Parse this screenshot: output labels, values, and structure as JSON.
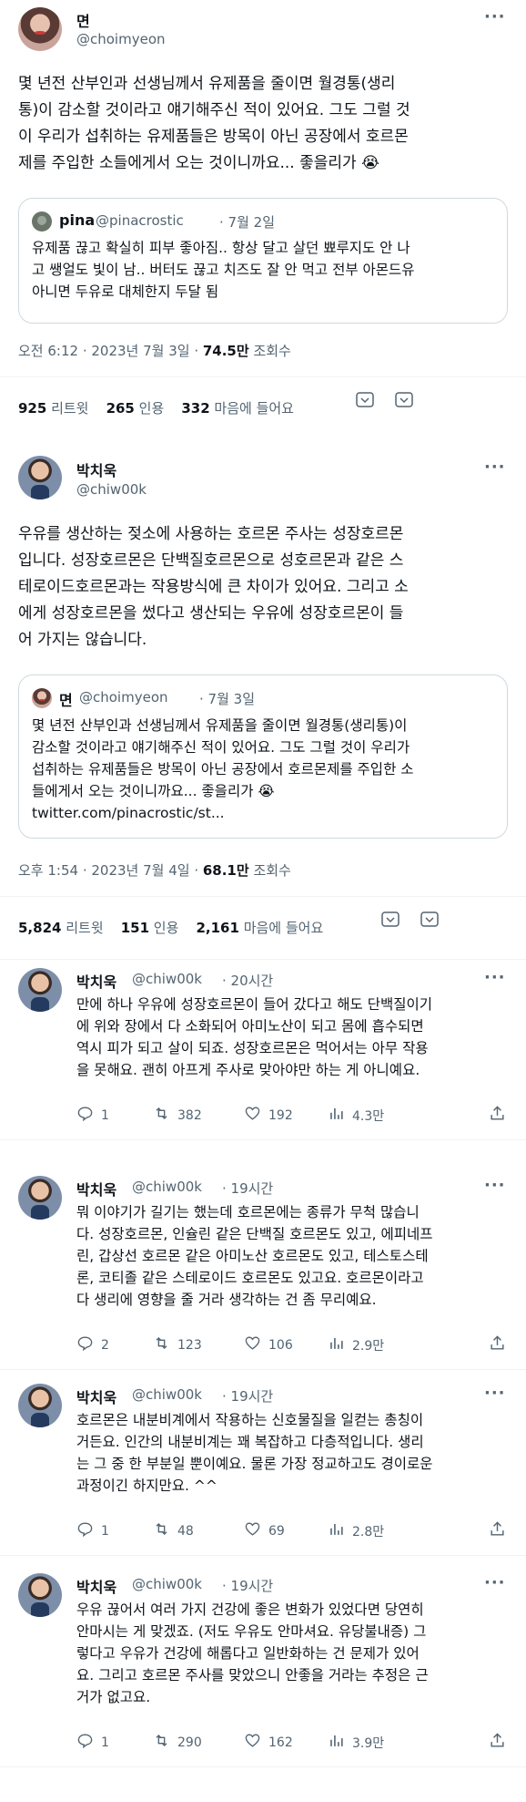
{
  "tweet1": {
    "name": "면",
    "handle": "@choimyeon",
    "text": "몇 년전 산부인과 선생님께서 유제품을 줄이면 월경통(생리\n통)이 감소할 것이라고 얘기해주신 적이 있어요. 그도 그럴 것\n이 우리가 섭취하는 유제품들은 방목이 아닌 공장에서 호르몬\n제를 주입한 소들에게서 오는 것이니까요... 좋을리가 😭",
    "quote": {
      "name": "pina",
      "handle": "@pinacrostic",
      "date": "· 7월 2일",
      "text": "유제품 끊고 확실히 피부 좋아짐.. 항상 달고 살던 뾰루지도 안 나\n고 쌩얼도 빛이 남.. 버터도 끊고 치즈도 잘 안 먹고 전부 아몬드유\n아니면 두유로 대체한지 두달 됨"
    },
    "time_prefix": "오전 6:12 · 2023년 7월 3일 · ",
    "views": "74.5만",
    "views_label": " 조회수",
    "retweets": "925",
    "retweets_label": " 리트윗",
    "quotes": "265",
    "quotes_label": " 인용",
    "likes": "332",
    "likes_label": " 마음에 들어요"
  },
  "tweet2": {
    "name": "박치욱",
    "handle": "@chiw00k",
    "text": "우유를 생산하는 젖소에 사용하는 호르몬 주사는 성장호르몬\n입니다. 성장호르몬은 단백질호르몬으로 성호르몬과 같은 스\n테로이드호르몬과는 작용방식에 큰 차이가 있어요. 그리고 소\n에게 성장호르몬을 썼다고 생산되는 우유에 성장호르몬이 들\n어 가지는 않습니다.",
    "quote": {
      "name": "면",
      "handle": "@choimyeon",
      "date": "· 7월 3일",
      "text": "몇 년전 산부인과 선생님께서 유제품을 줄이면 월경통(생리통)이\n감소할 것이라고 얘기해주신 적이 있어요. 그도 그럴 것이 우리가\n섭취하는 유제품들은 방목이 아닌 공장에서 호르몬제를 주입한 소\n들에게서 오는 것이니까요... 좋을리가 😭",
      "link": "twitter.com/pinacrostic/st..."
    },
    "time_prefix": "오후 1:54 · 2023년 7월 4일 · ",
    "views": "68.1만",
    "views_label": " 조회수",
    "retweets": "5,824",
    "retweets_label": " 리트윗",
    "quotes": "151",
    "quotes_label": " 인용",
    "likes": "2,161",
    "likes_label": " 마음에 들어요"
  },
  "replies": [
    {
      "name": "박치욱",
      "handle": "@chiw00k",
      "time": "· 20시간",
      "text": "만에 하나 우유에 성장호르몬이 들어 갔다고 해도 단백질이기\n에 위와 장에서 다 소화되어 아미노산이 되고 몸에 흡수되면\n역시 피가 되고 살이 되죠. 성장호르몬은 먹어서는 아무 작용\n을 못해요. 괜히 아프게 주사로 맞아야만 하는 게 아니예요.",
      "reply_count": "1",
      "retweet_count": "382",
      "like_count": "192",
      "view_count": "4.3만"
    },
    {
      "name": "박치욱",
      "handle": "@chiw00k",
      "time": "· 19시간",
      "text": "뭐 이야기가 길기는 했는데 호르몬에는 종류가 무척 많습니\n다. 성장호르몬, 인슐린 같은 단백질 호르몬도 있고, 에피네프\n린, 갑상선 호르몬 같은 아미노산 호르몬도 있고, 테스토스테\n론, 코티졸 같은 스테로이드 호르몬도 있고요. 호르몬이라고\n다 생리에 영향을 줄 거라 생각하는 건 좀 무리예요.",
      "reply_count": "2",
      "retweet_count": "123",
      "like_count": "106",
      "view_count": "2.9만"
    },
    {
      "name": "박치욱",
      "handle": "@chiw00k",
      "time": "· 19시간",
      "text": "호르몬은 내분비계에서 작용하는 신호물질을 일컫는 총칭이\n거든요. 인간의 내분비계는 꽤 복잡하고 다층적입니다. 생리\n는 그 중 한 부분일 뿐이예요. 물론 가장 정교하고도 경이로운\n과정이긴 하지만요. ^^",
      "reply_count": "1",
      "retweet_count": "48",
      "like_count": "69",
      "view_count": "2.8만"
    },
    {
      "name": "박치욱",
      "handle": "@chiw00k",
      "time": "· 19시간",
      "text": "우유 끊어서 여러 가지 건강에 좋은 변화가 있었다면 당연히\n안마시는 게 맞겠죠. (저도 우유도 안마셔요. 유당불내증) 그\n렇다고 우유가 건강에 해롭다고 일반화하는 건 문제가 있어\n요. 그리고 호르몬 주사를 맞았으니 안좋을 거라는 추정은 근\n거가 없고요.",
      "reply_count": "1",
      "retweet_count": "290",
      "like_count": "162",
      "view_count": "3.9만"
    }
  ],
  "colors": {
    "text": "#0f1419",
    "secondary": "#536471",
    "border": "#cfd9de",
    "divider": "#eff3f4"
  },
  "icons": [
    "more-icon",
    "reply-icon",
    "retweet-icon",
    "like-icon",
    "views-icon",
    "share-icon",
    "bookmark-icon"
  ]
}
